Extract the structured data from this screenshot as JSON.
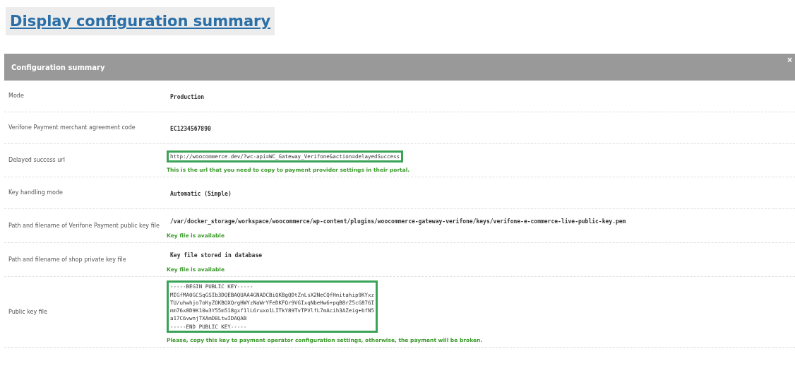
{
  "link": {
    "text": "Display configuration summary"
  },
  "panel": {
    "title": "Configuration summary",
    "close": "×"
  },
  "rows": [
    {
      "label": "Mode",
      "lines": [
        "Production"
      ],
      "highlighted": false
    },
    {
      "label": "Verifone Payment merchant agreement code",
      "lines": [
        "EC1234567890"
      ],
      "highlighted": false
    },
    {
      "label": "Delayed success url",
      "lines": [
        "http://woocommerce.dev/?wc-api=WC_Gateway_Verifone&action=delayedSuccess"
      ],
      "highlighted": true,
      "note": "This is the url that you need to copy to payment provider settings in their portal."
    },
    {
      "label": "Key handling mode",
      "lines": [
        "Automatic (Simple)"
      ],
      "highlighted": false
    },
    {
      "label": "Path and filename of Verifone Payment public key file",
      "lines": [
        "/var/docker_storage/workspace/woocommerce/wp-content/plugins/woocommerce-gateway-verifone/keys/verifone-e-commerce-live-public-key.pem"
      ],
      "highlighted": false,
      "note": "Key file is available"
    },
    {
      "label": "Path and filename of shop private key file",
      "lines": [
        "Key file stored in database"
      ],
      "highlighted": false,
      "note": "Key file is available"
    },
    {
      "label": "Public key file",
      "lines": [
        "-----BEGIN PUBLIC KEY-----",
        "MIGfMA0GCSqGSIb3DQEBAQUAA4GNADCBiQKBgQDtZnLsX2NeCQfHnitahip9KYxz",
        "TU/uhwhjo7oKyZOKBOXQrgHWYzNaWrYFeDKFQr9VGIxqNbeHw6+pqB8rZ5cG876I",
        "mm76x8D9K10w3Y55m518gxf1lL6ruxo1LITkY89TvTPVlfL7mAcih3AZeig+bfN5",
        "a17C6vwnjTXAmD0LtwIDAQAB",
        "-----END PUBLIC KEY-----"
      ],
      "highlighted": true,
      "note": "Please, copy this key to payment operator configuration settings, otherwise, the payment will be broken."
    }
  ]
}
